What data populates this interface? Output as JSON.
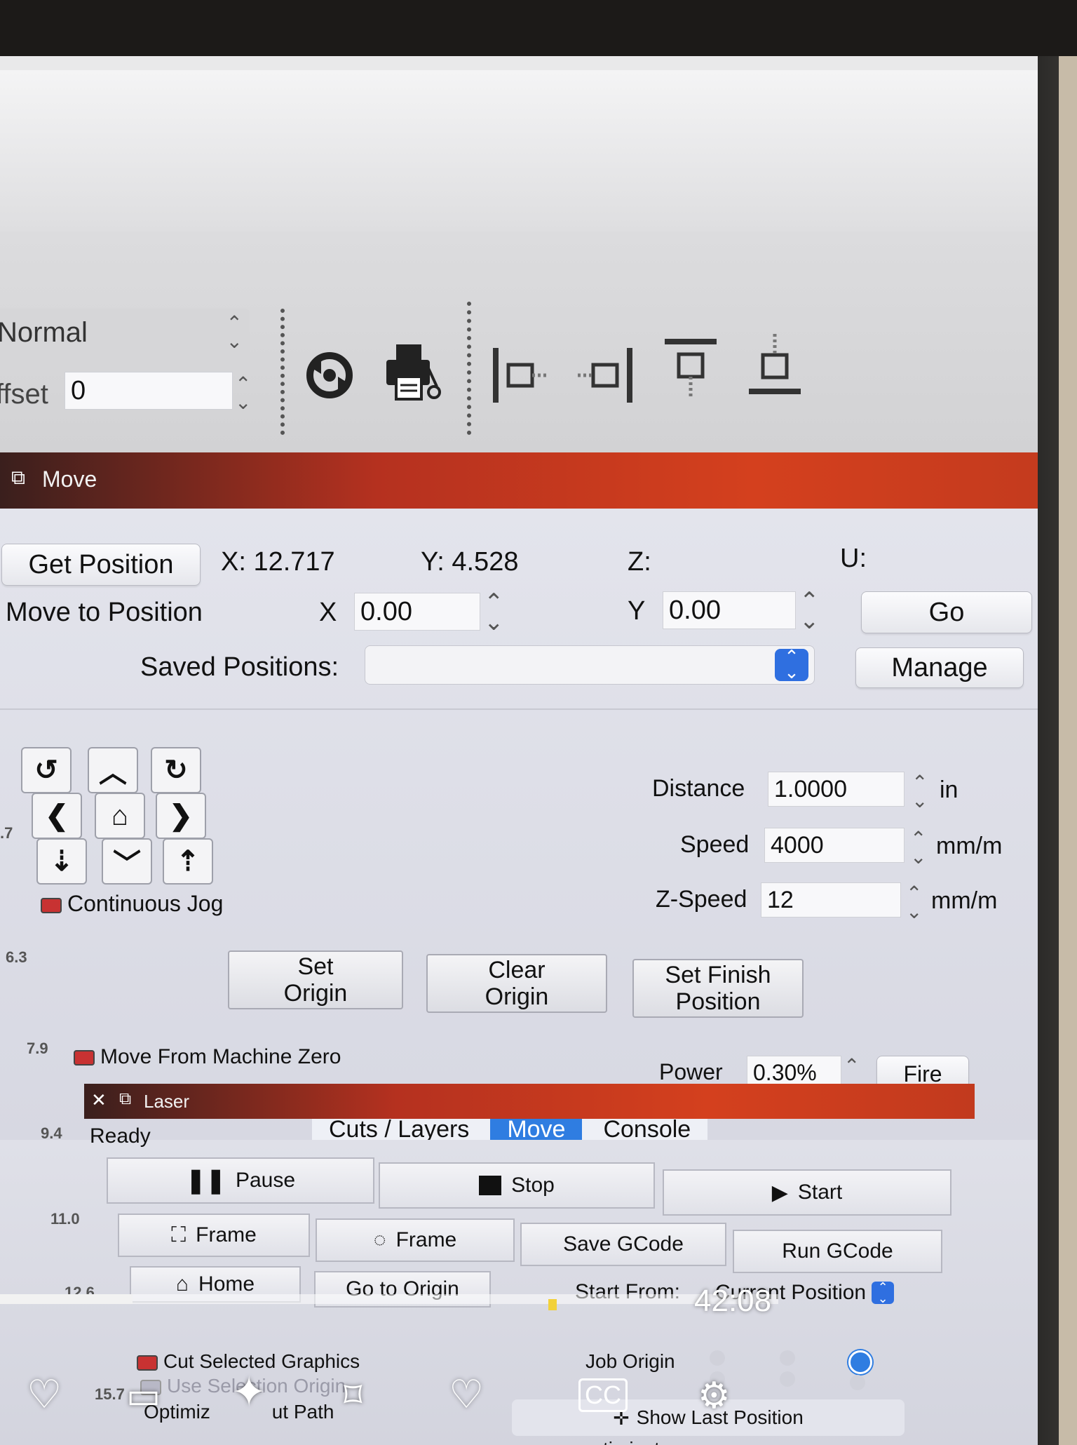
{
  "toolbar": {
    "mode_select": "Normal",
    "offset_label": "ffset",
    "offset_value": "0",
    "overflow_glyph": "»",
    "icons": [
      "rotary-icon",
      "print-cut-icon",
      "align-left-icon",
      "align-right-icon",
      "align-top-icon",
      "align-bottom-icon"
    ]
  },
  "move_panel": {
    "title": "Move",
    "get_position_label": "Get Position",
    "x_readout": "X: 12.717",
    "y_readout": "Y: 4.528",
    "z_readout": "Z:",
    "u_readout": "U:",
    "move_to_position_label": "Move to Position",
    "x_label": "X",
    "x_value": "0.00",
    "y_label": "Y",
    "y_value": "0.00",
    "go_label": "Go",
    "saved_positions_label": "Saved Positions:",
    "saved_positions_value": "",
    "manage_label": "Manage",
    "distance_label": "Distance",
    "distance_value": "1.0000",
    "distance_unit": "in",
    "speed_label": "Speed",
    "speed_value": "4000",
    "speed_unit": "mm/m",
    "zspeed_label": "Z-Speed",
    "zspeed_value": "12",
    "zspeed_unit": "mm/m",
    "continuous_jog_label": "Continuous Jog",
    "set_origin_label": "Set\nOrigin",
    "clear_origin_label": "Clear\nOrigin",
    "set_finish_label": "Set Finish\nPosition",
    "move_from_zero_label": "Move From Machine Zero",
    "power_label": "Power",
    "power_value": "0.30%",
    "fire_label": "Fire",
    "ruler_marks": [
      ".7",
      "6.3",
      "7.9",
      "9.4",
      "11.0",
      "12.6",
      "15.7"
    ]
  },
  "tabs": [
    "Cuts / Layers",
    "Move",
    "Console"
  ],
  "active_tab": "Move",
  "laser_panel": {
    "title": "Laser",
    "status": "Ready",
    "pause_label": "Pause",
    "stop_label": "Stop",
    "start_label": "Start",
    "frame1_label": "Frame",
    "frame2_label": "Frame",
    "save_gcode_label": "Save GCode",
    "run_gcode_label": "Run GCode",
    "home_label": "Home",
    "go_to_origin_label": "Go to Origin",
    "start_from_label": "Start From:",
    "start_from_value": "Current Position",
    "cut_selected_label": "Cut Selected Graphics",
    "use_selection_origin_label": "Use Selection Origin",
    "optimize_path_label": "Optimiz",
    "optimize_path_suffix": "ut Path",
    "job_origin_label": "Job Origin",
    "show_last_position_label": "Show Last Position",
    "optimization_label": "timizat"
  },
  "video_overlay": {
    "time": "42:08",
    "progress_fraction": 0.17
  }
}
